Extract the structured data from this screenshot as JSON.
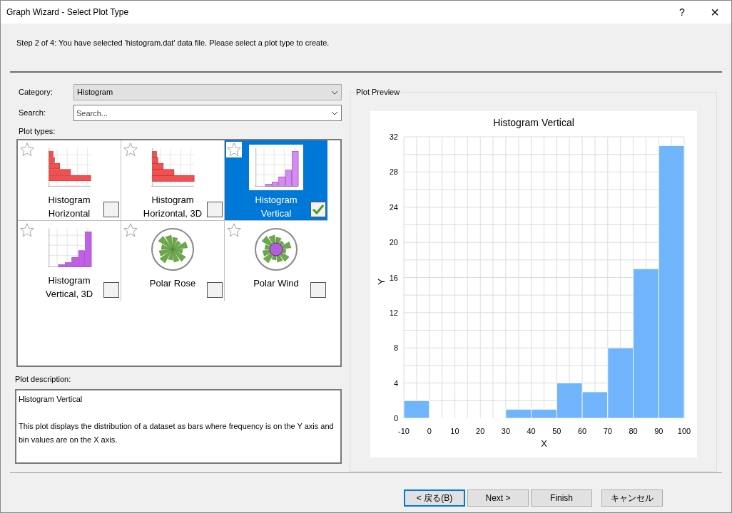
{
  "window": {
    "title": "Graph Wizard - Select Plot Type",
    "help": "?",
    "close": "×"
  },
  "step": "Step 2 of 4:  You have selected 'histogram.dat' data file. Please select a plot type to create.",
  "category": {
    "label": "Category:",
    "value": "Histogram"
  },
  "search": {
    "label": "Search:",
    "placeholder": "Search..."
  },
  "plot_types_label": "Plot types:",
  "plot_types": [
    {
      "label": "Histogram Horizontal",
      "kind": "hbar",
      "selected": false,
      "checked": false
    },
    {
      "label": "Histogram Horizontal, 3D",
      "kind": "hbar3d",
      "selected": false,
      "checked": false
    },
    {
      "label": "Histogram Vertical",
      "kind": "vbar",
      "selected": true,
      "checked": true
    },
    {
      "label": "Histogram Vertical, 3D",
      "kind": "vbar3d",
      "selected": false,
      "checked": false
    },
    {
      "label": "Polar Rose",
      "kind": "rose",
      "selected": false,
      "checked": false
    },
    {
      "label": "Polar Wind",
      "kind": "wind",
      "selected": false,
      "checked": false
    }
  ],
  "description": {
    "label": "Plot description:",
    "title": "Histogram Vertical",
    "text": "This plot displays the distribution of a dataset as bars where frequency is on the Y axis and bin values are on the X axis."
  },
  "preview": {
    "label": "Plot Preview",
    "chart_data": {
      "type": "bar",
      "title": "Histogram Vertical",
      "xlabel": "X",
      "ylabel": "Y",
      "x": [
        -5,
        5,
        15,
        25,
        35,
        45,
        55,
        65,
        75,
        85,
        95
      ],
      "grid": true,
      "series": [
        {
          "color": "#70b4fb",
          "values": [
            2,
            0,
            0,
            0,
            1,
            1,
            4,
            3,
            8,
            17,
            31
          ]
        }
      ],
      "xlim": [
        -10,
        100
      ],
      "ylim": [
        0,
        32
      ],
      "xticks": [
        -10,
        0,
        10,
        20,
        30,
        40,
        50,
        60,
        70,
        80,
        90,
        100
      ],
      "yticks": [
        0,
        4,
        8,
        12,
        16,
        20,
        24,
        28,
        32
      ]
    }
  },
  "buttons": [
    {
      "label": "< 戻る(B)",
      "focused": true
    },
    {
      "label": "Next >",
      "focused": false
    },
    {
      "label": "Finish",
      "focused": false
    },
    {
      "label": "キャンセル",
      "focused": false
    }
  ]
}
